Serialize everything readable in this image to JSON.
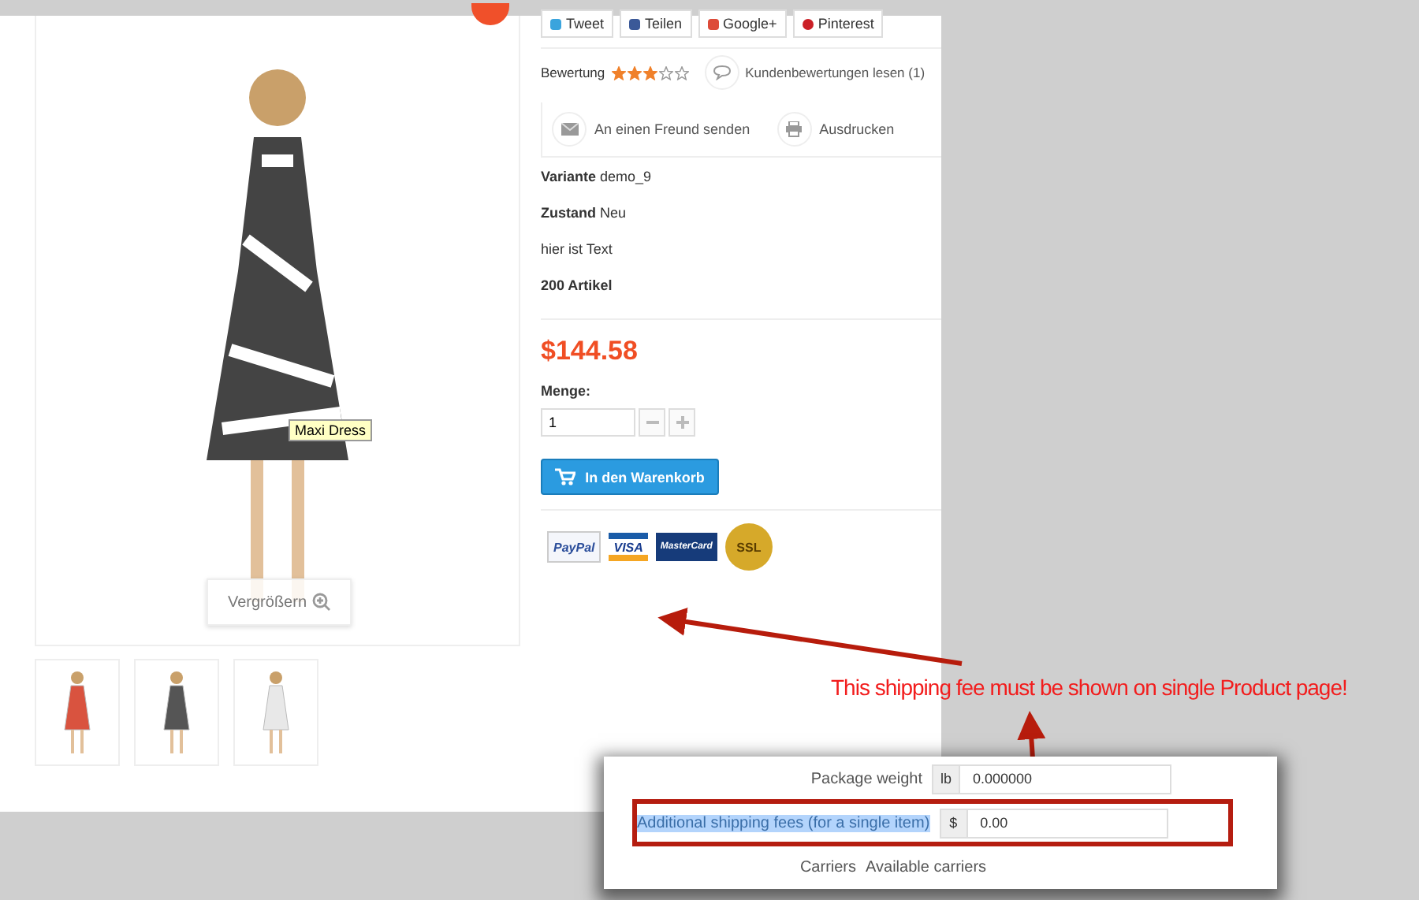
{
  "image": {
    "tooltip": "Maxi Dress",
    "zoom_button": "Vergrößern"
  },
  "thumbnails": [
    {
      "color": "#d9533f"
    },
    {
      "color": "#555555"
    },
    {
      "color": "#e8e8e8"
    }
  ],
  "social_buttons": [
    {
      "label": "Tweet",
      "kind": "twitter"
    },
    {
      "label": "Teilen",
      "kind": "facebook"
    },
    {
      "label": "Google+",
      "kind": "google"
    },
    {
      "label": "Pinterest",
      "kind": "pinterest"
    }
  ],
  "rating": {
    "label": "Bewertung",
    "stars": 3
  },
  "review_link": "Kundenbewertungen lesen (1)",
  "actions": [
    {
      "label": "An einen Freund senden",
      "kind": "mail"
    },
    {
      "label": "Ausdrucken",
      "kind": "print"
    }
  ],
  "details": [
    {
      "label": "Variante",
      "value": "demo_9"
    },
    {
      "label": "Zustand",
      "value": "Neu"
    }
  ],
  "description": "hier ist Text",
  "stock": "200 Artikel",
  "price": "$144.58",
  "quantity": {
    "label": "Menge:",
    "value": "1"
  },
  "cart_button": "In den Warenkorb",
  "payment_logos": [
    {
      "label": "PayPal",
      "kind": "paypal"
    },
    {
      "label": "VISA",
      "kind": "visa"
    },
    {
      "label": "MasterCard",
      "kind": "mastercard"
    },
    {
      "label": "SSL",
      "kind": "ssl"
    }
  ],
  "annotation": "This shipping fee must be shown on single Product page!",
  "admin_panel": {
    "fields": [
      {
        "label": "Package weight",
        "unit": "lb",
        "value": "0.000000",
        "highlighted": false
      },
      {
        "label": "Additional shipping fees (for a single item)",
        "unit": "$",
        "value": "0.00",
        "highlighted": true
      }
    ],
    "next_label": "Carriers",
    "next_value": "Available carriers"
  }
}
